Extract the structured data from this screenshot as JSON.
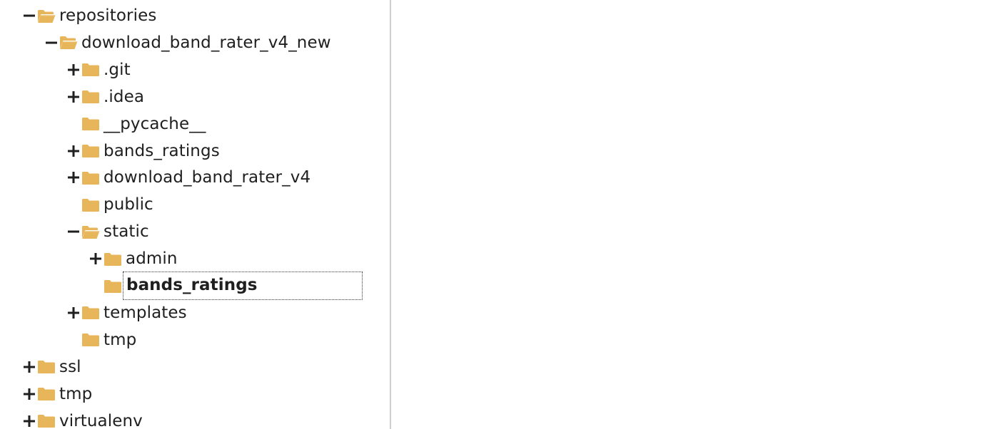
{
  "tree": {
    "items": [
      {
        "label": "repositories",
        "toggle": "collapse",
        "folder": "open",
        "depth": 0
      },
      {
        "label": "download_band_rater_v4_new",
        "toggle": "collapse",
        "folder": "open",
        "depth": 1
      },
      {
        "label": ".git",
        "toggle": "expand",
        "folder": "closed",
        "depth": 2
      },
      {
        "label": ".idea",
        "toggle": "expand",
        "folder": "closed",
        "depth": 2
      },
      {
        "label": "__pycache__",
        "toggle": "none",
        "folder": "closed",
        "depth": 2
      },
      {
        "label": "bands_ratings",
        "toggle": "expand",
        "folder": "closed",
        "depth": 2
      },
      {
        "label": "download_band_rater_v4",
        "toggle": "expand",
        "folder": "closed",
        "depth": 2
      },
      {
        "label": "public",
        "toggle": "none",
        "folder": "closed",
        "depth": 2
      },
      {
        "label": "static",
        "toggle": "collapse",
        "folder": "open",
        "depth": 2
      },
      {
        "label": "admin",
        "toggle": "expand",
        "folder": "closed",
        "depth": 3
      },
      {
        "label": "bands_ratings",
        "toggle": "none",
        "folder": "closed",
        "depth": 3,
        "selected": true
      },
      {
        "label": "templates",
        "toggle": "expand",
        "folder": "closed",
        "depth": 2
      },
      {
        "label": "tmp",
        "toggle": "none",
        "folder": "closed",
        "depth": 2
      },
      {
        "label": "ssl",
        "toggle": "expand",
        "folder": "closed",
        "depth": 0
      },
      {
        "label": "tmp",
        "toggle": "expand",
        "folder": "closed",
        "depth": 0
      },
      {
        "label": "virtualenv",
        "toggle": "expand",
        "folder": "closed",
        "depth": 0
      }
    ]
  },
  "colors": {
    "folder": "#E8B65A",
    "folder_dark": "#D9A443",
    "toggle": "#1f1f1f",
    "splitter": "#cfcfcf"
  },
  "icons": {
    "expand": "plus-icon",
    "collapse": "minus-icon",
    "folder_closed": "folder-icon",
    "folder_open": "folder-open-icon"
  }
}
